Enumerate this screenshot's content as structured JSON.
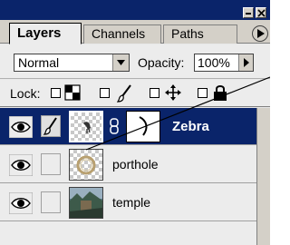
{
  "tabs": {
    "layers": "Layers",
    "channels": "Channels",
    "paths": "Paths"
  },
  "blend": {
    "mode": "Normal",
    "opacity_label": "Opacity:",
    "opacity_value": "100%"
  },
  "lock": {
    "label": "Lock:"
  },
  "layers": [
    {
      "name": "Zebra",
      "selected": true,
      "visible": true,
      "linked_mask": true
    },
    {
      "name": "porthole",
      "selected": false,
      "visible": true
    },
    {
      "name": "temple",
      "selected": false,
      "visible": true
    }
  ],
  "colors": {
    "selection": "#0a246a",
    "panel": "#ececec",
    "chrome": "#d4d0c8"
  }
}
